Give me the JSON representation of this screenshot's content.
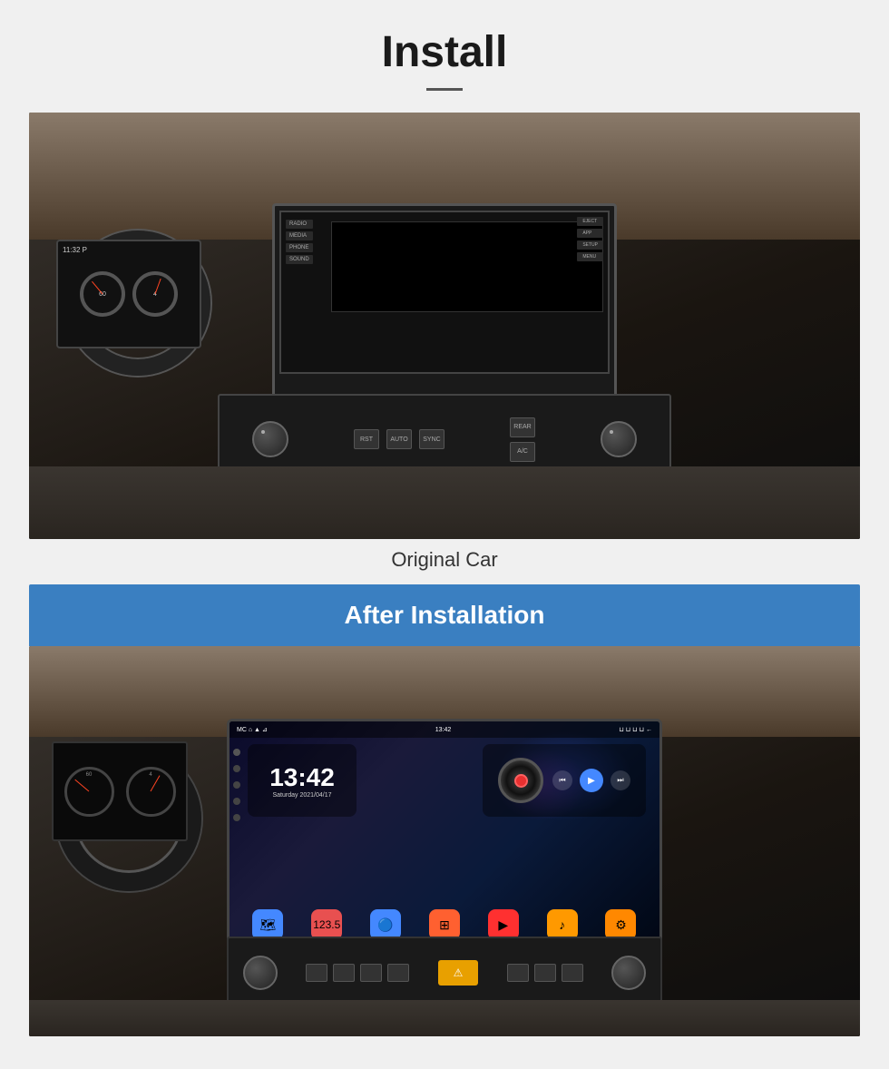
{
  "page": {
    "title": "Install",
    "originalCarLabel": "Original Car",
    "afterInstallationLabel": "After  Installation",
    "androidTime": "13:42",
    "androidDate": "Saturday  2021/04/17",
    "statusBarTime": "13:42",
    "appIcons": [
      {
        "label": "Navigation",
        "color": "#4488ff",
        "icon": "🗺"
      },
      {
        "label": "Radio",
        "color": "#e85050",
        "icon": "📻"
      },
      {
        "label": "Bluetooth",
        "color": "#4488ff",
        "icon": "🔵"
      },
      {
        "label": "Apps",
        "color": "#ff6030",
        "icon": "⊞"
      },
      {
        "label": "Video",
        "color": "#ff3030",
        "icon": "▶"
      },
      {
        "label": "Music",
        "color": "#ff9900",
        "icon": "♪"
      },
      {
        "label": "Settings",
        "color": "#ff8800",
        "icon": "⚙"
      }
    ],
    "mediaBtns": {
      "prev": "⏮",
      "play": "▶",
      "next": "⏭"
    },
    "colors": {
      "accent": "#3a7fc1",
      "background": "#f0f0f0",
      "titleText": "#1a1a1a",
      "captionText": "#333"
    }
  }
}
